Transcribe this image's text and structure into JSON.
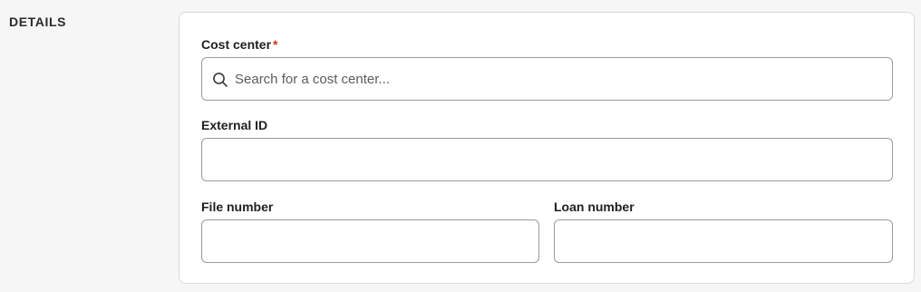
{
  "section": {
    "title": "DETAILS"
  },
  "fields": {
    "cost_center": {
      "label": "Cost center",
      "required_mark": "*",
      "placeholder": "Search for a cost center...",
      "value": "",
      "icon": "search-icon"
    },
    "external_id": {
      "label": "External ID",
      "value": ""
    },
    "file_number": {
      "label": "File number",
      "value": ""
    },
    "loan_number": {
      "label": "Loan number",
      "value": ""
    }
  },
  "colors": {
    "required": "#d4321f",
    "border": "#9a9aa2",
    "background": "#f6f6f7"
  }
}
